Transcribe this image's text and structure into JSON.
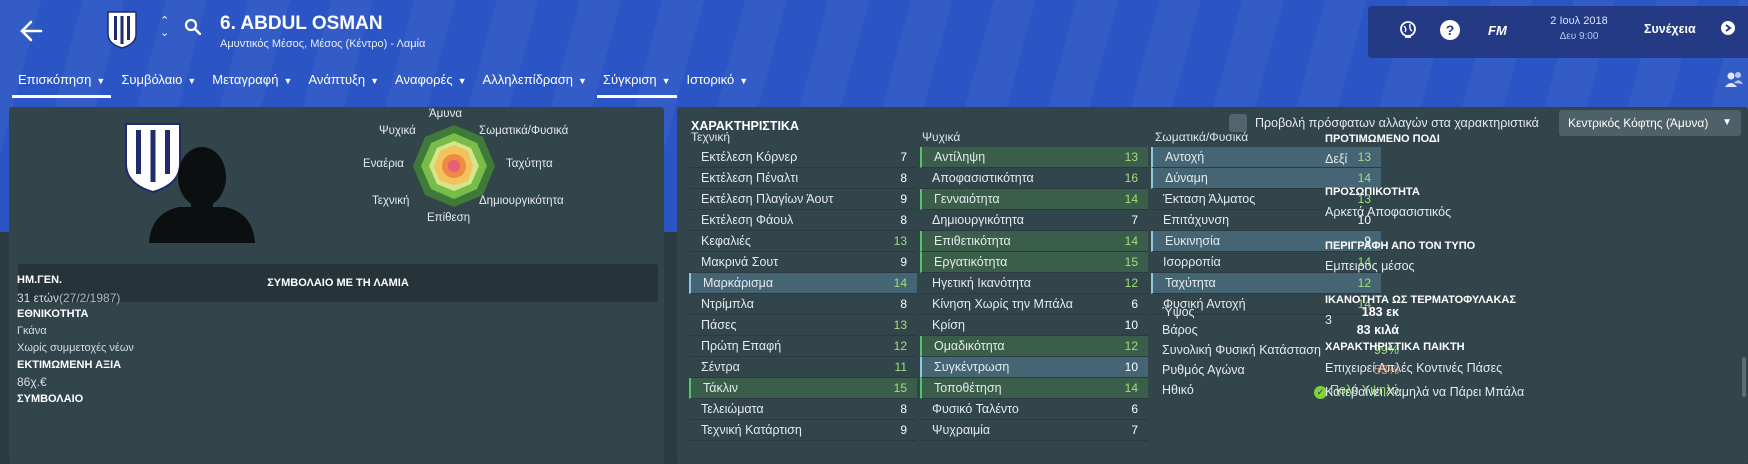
{
  "header": {
    "player_name": "6. ABDUL OSMAN",
    "player_subtitle": "Αμυντικός Μέσος, Μέσος (Κέντρο) - Λαμία",
    "date": "2 Ιουλ 2018",
    "time": "Δευ 9:00",
    "fm_label": "FM",
    "continue_label": "Συνέχεια",
    "help_label": "?"
  },
  "tabs": [
    {
      "label": "Επισκόπηση"
    },
    {
      "label": "Συμβόλαιο"
    },
    {
      "label": "Μεταγραφή"
    },
    {
      "label": "Ανάπτυξη"
    },
    {
      "label": "Αναφορές"
    },
    {
      "label": "Αλληλεπίδραση"
    },
    {
      "label": "Σύγκριση"
    },
    {
      "label": "Ιστορικό"
    }
  ],
  "left": {
    "radar_labels": {
      "defence": "Άμυνα",
      "physical": "Σωματικά/Φυσικά",
      "speed": "Ταχύτητα",
      "creativity": "Δημιουργικότητα",
      "attack": "Επίθεση",
      "technical": "Τεχνική",
      "aerial": "Εναέρια",
      "mental": "Ψυχικά"
    },
    "contract_label": "ΣΥΜΒΟΛΑΙΟ ΜΕ ΤΗ ΛΑΜΙΑ",
    "dob_label": "ΗΜ.ΓΕΝ.",
    "dob_value": "31 ετών",
    "dob_date": "(27/2/1987)",
    "nationality_label": "ΕΘΝΙΚΟΤΗΤΑ",
    "nationality_value": "Γκάνα",
    "caps_value": "Χωρίς συμμετοχές νέων",
    "value_label": "ΕΚΤΙΜΩΜΕΝΗ ΑΞΙΑ",
    "value_value": "86χ.€",
    "contract_section_label": "ΣΥΜΒΟΛΑΙΟ"
  },
  "attributes": {
    "title": "ΧΑΡΑΚΤΗΡΙΣΤΙΚΑ",
    "recent_changes_label": "Προβολή πρόσφατων αλλαγών στα χαρακτηριστικά",
    "role_select": "Κεντρικός Κόφτης (Άμυνα)",
    "technical_title": "Τεχνική",
    "mental_title": "Ψυχικά",
    "physical_title": "Σωματικά/Φυσικά",
    "technical": [
      {
        "name": "Εκτέλεση Κόρνερ",
        "v": "7"
      },
      {
        "name": "Εκτέλεση Πέναλτι",
        "v": "8"
      },
      {
        "name": "Εκτέλεση Πλαγίων Άουτ",
        "v": "9"
      },
      {
        "name": "Εκτέλεση Φάουλ",
        "v": "8"
      },
      {
        "name": "Κεφαλιές",
        "v": "13"
      },
      {
        "name": "Μακρινά Σουτ",
        "v": "9"
      },
      {
        "name": "Μαρκάρισμα",
        "v": "14"
      },
      {
        "name": "Ντρίμπλα",
        "v": "8"
      },
      {
        "name": "Πάσες",
        "v": "13"
      },
      {
        "name": "Πρώτη Επαφή",
        "v": "12"
      },
      {
        "name": "Σέντρα",
        "v": "11"
      },
      {
        "name": "Τάκλιν",
        "v": "15"
      },
      {
        "name": "Τελειώματα",
        "v": "8"
      },
      {
        "name": "Τεχνική Κατάρτιση",
        "v": "9"
      }
    ],
    "mental": [
      {
        "name": "Αντίληψη",
        "v": "13"
      },
      {
        "name": "Αποφασιστικότητα",
        "v": "16"
      },
      {
        "name": "Γενναιότητα",
        "v": "14"
      },
      {
        "name": "Δημιουργικότητα",
        "v": "7"
      },
      {
        "name": "Επιθετικότητα",
        "v": "14"
      },
      {
        "name": "Εργατικότητα",
        "v": "15"
      },
      {
        "name": "Ηγετική Ικανότητα",
        "v": "12"
      },
      {
        "name": "Κίνηση Χωρίς την Μπάλα",
        "v": "6"
      },
      {
        "name": "Κρίση",
        "v": "10"
      },
      {
        "name": "Ομαδικότητα",
        "v": "12"
      },
      {
        "name": "Συγκέντρωση",
        "v": "10"
      },
      {
        "name": "Τοποθέτηση",
        "v": "14"
      },
      {
        "name": "Φυσικό Ταλέντο",
        "v": "6"
      },
      {
        "name": "Ψυχραιμία",
        "v": "7"
      }
    ],
    "physical": [
      {
        "name": "Αντοχή",
        "v": "13"
      },
      {
        "name": "Δύναμη",
        "v": "14"
      },
      {
        "name": "Έκταση Άλματος",
        "v": "13"
      },
      {
        "name": "Επιτάχυνση",
        "v": "10"
      },
      {
        "name": "Ευκινησία",
        "v": "9"
      },
      {
        "name": "Ισορροπία",
        "v": "14"
      },
      {
        "name": "Ταχύτητα",
        "v": "12"
      },
      {
        "name": "Φυσική Αντοχή",
        "v": "14"
      }
    ],
    "extra": [
      {
        "name": "Ύψος",
        "v": "183 εκ"
      },
      {
        "name": "Βάρος",
        "v": "83 κιλά"
      },
      {
        "name": "Συνολική Φυσική Κατάσταση",
        "v": "99%"
      },
      {
        "name": "Ρυθμός Αγώνα",
        "v": "53%"
      },
      {
        "name": "Ηθικό",
        "v": "Πολύ Υψηλό"
      }
    ]
  },
  "info": {
    "foot_label": "ΠΡΟΤΙΜΩΜΕΝΟ ΠΟΔΙ",
    "foot_value": "Δεξί",
    "personality_label": "ΠΡΟΣΩΠΙΚΟΤΗΤΑ",
    "personality_value": "Αρκετά Αποφασιστικός",
    "media_label": "ΠΕΡΙΓΡΑΦΗ ΑΠΟ ΤΟΝ ΤΥΠΟ",
    "media_value": "Εμπειρος μέσος",
    "gk_label": "ΙΚΑΝΟΤΗΤΑ ΩΣ ΤΕΡΜΑΤΟΦΥΛΑΚΑΣ",
    "gk_value": "3",
    "traits_label": "ΧΑΡΑΚΤΗΡΙΣΤΙΚΑ ΠΑΙΚΤΗ",
    "traits": [
      "Επιχειρεί Απλές Κοντινές Πάσες",
      "Κατεβαίνει Χαμηλά να Πάρει Μπάλα"
    ]
  },
  "colors": {
    "header": "#2b55c4",
    "panel": "#32454b",
    "green": "#9fe07a",
    "orange": "#f08a5d"
  }
}
